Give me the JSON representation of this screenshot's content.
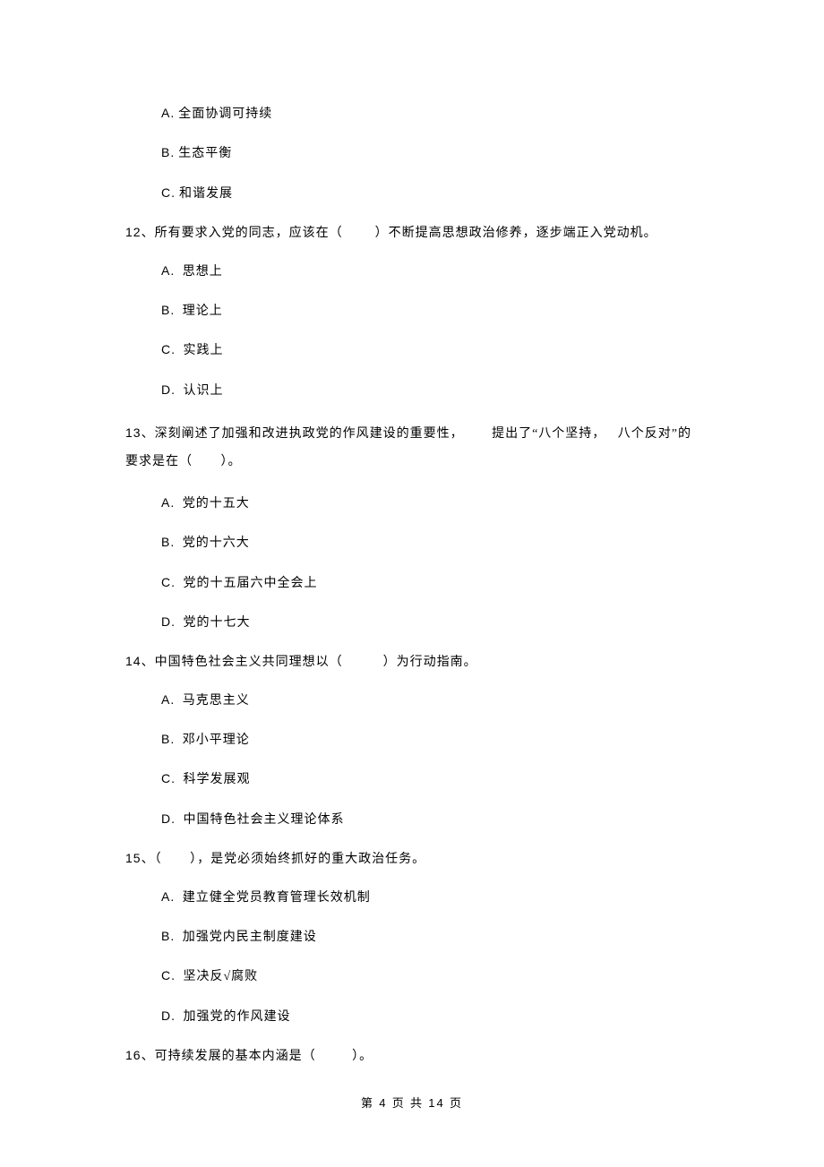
{
  "questions": {
    "q11_partial": {
      "options": [
        {
          "letter": "A.",
          "text": "全面协调可持续"
        },
        {
          "letter": "B.",
          "text": "生态平衡"
        },
        {
          "letter": "C.",
          "text": "和谐发展"
        }
      ]
    },
    "q12": {
      "num": "12",
      "sep": "、",
      "text_prefix": "所有要求入党的同志，应该在（",
      "blank": "        ",
      "text_suffix": "）不断提高思想政治修养，逐步端正入党动机。",
      "options": [
        {
          "letter": "A.",
          "text": " 思想上"
        },
        {
          "letter": "B.",
          "text": " 理论上"
        },
        {
          "letter": "C.",
          "text": " 实践上"
        },
        {
          "letter": "D.",
          "text": " 认识上"
        }
      ]
    },
    "q13": {
      "num": "13",
      "sep": "、",
      "line1": "深刻阐述了加强和改进执政党的作风建设的重要性，       提出了“八个坚持，   八个反对”的",
      "line2": "要求是在（       ）。",
      "options": [
        {
          "letter": "A.",
          "text": " 党的十五大"
        },
        {
          "letter": "B.",
          "text": " 党的十六大"
        },
        {
          "letter": "C.",
          "text": " 党的十五届六中全会上"
        },
        {
          "letter": "D.",
          "text": " 党的十七大"
        }
      ]
    },
    "q14": {
      "num": "14",
      "sep": "、",
      "text_prefix": "中国特色社会主义共同理想以（",
      "blank": "          ",
      "text_suffix": "）为行动指南。",
      "options": [
        {
          "letter": "A.",
          "text": " 马克思主义"
        },
        {
          "letter": "B.",
          "text": " 邓小平理论"
        },
        {
          "letter": "C.",
          "text": " 科学发展观"
        },
        {
          "letter": "D.",
          "text": " 中国特色社会主义理论体系"
        }
      ]
    },
    "q15": {
      "num": "15",
      "sep": "、",
      "text_prefix": "（",
      "blank": "       ",
      "text_suffix": "），是党必须始终抓好的重大政治任务。",
      "options": [
        {
          "letter": "A.",
          "text": " 建立健全党员教育管理长效机制"
        },
        {
          "letter": "B.",
          "text": " 加强党内民主制度建设"
        },
        {
          "letter": "C.",
          "text": " 坚决反√腐败"
        },
        {
          "letter": "D.",
          "text": " 加强党的作风建设"
        }
      ]
    },
    "q16": {
      "num": "16",
      "sep": "、",
      "text_prefix": "可持续发展的基本内涵是（",
      "blank": "         ",
      "text_suffix": "）。"
    }
  },
  "footer": {
    "prefix": "第 ",
    "current": "4",
    "mid": " 页 共 ",
    "total": "14",
    "suffix": " 页"
  }
}
